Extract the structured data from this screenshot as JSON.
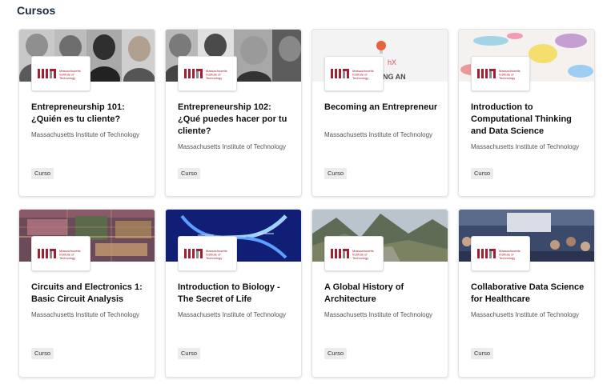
{
  "section": {
    "title": "Cursos"
  },
  "courses": [
    {
      "title": "Entrepreneurship 101: ¿Quién es tu cliente?",
      "org": "Massachusetts Institute of Technology",
      "badge": "Curso",
      "logo_word": "MIT",
      "logo_text": "Massachusetts Institute of Technology",
      "banner": "people-grayscale-photo"
    },
    {
      "title": "Entrepreneurship 102: ¿Qué puedes hacer por tu cliente?",
      "org": "Massachusetts Institute of Technology",
      "badge": "Curso",
      "logo_word": "MIT",
      "logo_text": "Massachusetts Institute of Technology",
      "banner": "people-grayscale-photo"
    },
    {
      "title": "Becoming an Entrepreneur",
      "org": "Massachusetts Institute of Technology",
      "badge": "Curso",
      "logo_word": "MIT",
      "logo_text": "Massachusetts Institute of Technology",
      "banner": "mitx-lightbulb-banner"
    },
    {
      "title": "Introduction to Computational Thinking and Data Science",
      "org": "Massachusetts Institute of Technology",
      "badge": "Curso",
      "logo_word": "MIT",
      "logo_text": "Massachusetts Institute of Technology",
      "banner": "colorful-data-splash"
    },
    {
      "title": "Circuits and Electronics 1: Basic Circuit Analysis",
      "org": "Massachusetts Institute of Technology",
      "badge": "Curso",
      "logo_word": "MIT",
      "logo_text": "Massachusetts Institute of Technology",
      "banner": "circuit-board"
    },
    {
      "title": "Introduction to Biology - The Secret of Life",
      "org": "Massachusetts Institute of Technology",
      "badge": "Curso",
      "logo_word": "MIT",
      "logo_text": "Massachusetts Institute of Technology",
      "banner": "dna-helix"
    },
    {
      "title": "A Global History of Architecture",
      "org": "Massachusetts Institute of Technology",
      "badge": "Curso",
      "logo_word": "MIT",
      "logo_text": "Massachusetts Institute of Technology",
      "banner": "mountain-ruins"
    },
    {
      "title": "Collaborative Data Science for Healthcare",
      "org": "Massachusetts Institute of Technology",
      "badge": "Curso",
      "logo_word": "MIT",
      "logo_text": "Massachusetts Institute of Technology",
      "banner": "crowd-photo"
    }
  ],
  "banners": {
    "mitx_fragment": "hX",
    "mitx_caption": "NG AN"
  },
  "colors": {
    "mit_red": "#a31f34",
    "mit_gray": "#8a8b8c",
    "title_text": "#1a2b3c",
    "badge_bg": "#ececec"
  }
}
